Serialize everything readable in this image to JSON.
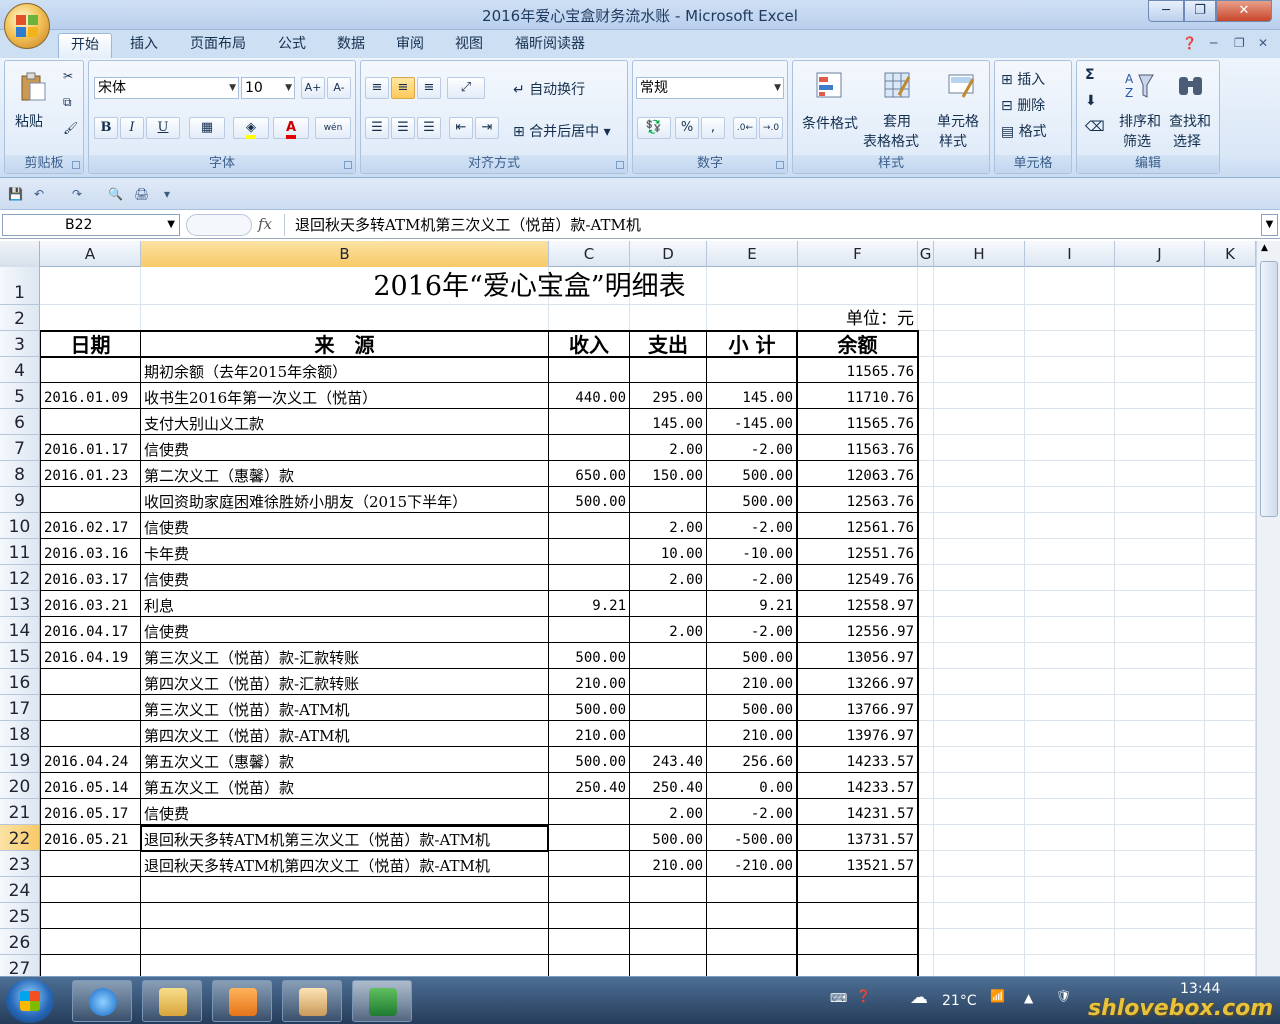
{
  "window": {
    "title": "2016年爱心宝盒财务流水账 - Microsoft Excel",
    "min": "─",
    "max": "❐",
    "close": "✕"
  },
  "tabs": [
    "开始",
    "插入",
    "页面布局",
    "公式",
    "数据",
    "审阅",
    "视图",
    "福昕阅读器"
  ],
  "ribbon": {
    "clipboard": {
      "paste": "粘贴",
      "label": "剪贴板"
    },
    "font": {
      "name": "宋体",
      "size": "10",
      "bold": "B",
      "italic": "I",
      "underline": "U",
      "label": "字体",
      "grow": "A+",
      "shrink": "A-",
      "phonetic": "wén"
    },
    "alignment": {
      "wrap": "自动换行",
      "merge": "合并后居中",
      "label": "对齐方式"
    },
    "number": {
      "format": "常规",
      "percent": "%",
      "comma": ",",
      "label": "数字"
    },
    "styles": {
      "conditional": "条件格式",
      "table_l1": "套用",
      "table_l2": "表格格式",
      "cell_l1": "单元格",
      "cell_l2": "样式",
      "label": "样式"
    },
    "cells": {
      "insert": "插入",
      "delete": "删除",
      "format": "格式",
      "label": "单元格"
    },
    "editing": {
      "sort_l1": "排序和",
      "sort_l2": "筛选",
      "find_l1": "查找和",
      "find_l2": "选择",
      "sum": "Σ",
      "label": "编辑"
    }
  },
  "formula_bar": {
    "name_box": "B22",
    "fx": "fx",
    "content": "退回秋天多转ATM机第三次义工（悦苗）款-ATM机"
  },
  "columns": [
    "A",
    "B",
    "C",
    "D",
    "E",
    "F",
    "G",
    "H",
    "I",
    "J",
    "K"
  ],
  "selected_column": "B",
  "selected_row": "22",
  "sheet": {
    "title": "2016年“爱心宝盒”明细表",
    "unit": "单位：元",
    "headers": {
      "date": "日期",
      "source": "来　源",
      "income": "收入",
      "expense": "支出",
      "subtotal": "小 计",
      "balance": "余额"
    },
    "rows": [
      {
        "r": "4",
        "date": "",
        "source": "期初余额（去年2015年余额）",
        "income": "",
        "expense": "",
        "subtotal": "",
        "balance": "11565.76"
      },
      {
        "r": "5",
        "date": "2016.01.09",
        "source": "收书生2016年第一次义工（悦苗）",
        "income": "440.00",
        "expense": "295.00",
        "subtotal": "145.00",
        "balance": "11710.76"
      },
      {
        "r": "6",
        "date": "",
        "source": "支付大别山义工款",
        "income": "",
        "expense": "145.00",
        "subtotal": "-145.00",
        "balance": "11565.76"
      },
      {
        "r": "7",
        "date": "2016.01.17",
        "source": "信使费",
        "income": "",
        "expense": "2.00",
        "subtotal": "-2.00",
        "balance": "11563.76"
      },
      {
        "r": "8",
        "date": "2016.01.23",
        "source": "第二次义工（惠馨）款",
        "income": "650.00",
        "expense": "150.00",
        "subtotal": "500.00",
        "balance": "12063.76"
      },
      {
        "r": "9",
        "date": "",
        "source": "收回资助家庭困难徐胜娇小朋友（2015下半年）",
        "income": "500.00",
        "expense": "",
        "subtotal": "500.00",
        "balance": "12563.76"
      },
      {
        "r": "10",
        "date": "2016.02.17",
        "source": "信使费",
        "income": "",
        "expense": "2.00",
        "subtotal": "-2.00",
        "balance": "12561.76"
      },
      {
        "r": "11",
        "date": "2016.03.16",
        "source": "卡年费",
        "income": "",
        "expense": "10.00",
        "subtotal": "-10.00",
        "balance": "12551.76"
      },
      {
        "r": "12",
        "date": "2016.03.17",
        "source": "信使费",
        "income": "",
        "expense": "2.00",
        "subtotal": "-2.00",
        "balance": "12549.76"
      },
      {
        "r": "13",
        "date": "2016.03.21",
        "source": "利息",
        "income": "9.21",
        "expense": "",
        "subtotal": "9.21",
        "balance": "12558.97"
      },
      {
        "r": "14",
        "date": "2016.04.17",
        "source": "信使费",
        "income": "",
        "expense": "2.00",
        "subtotal": "-2.00",
        "balance": "12556.97"
      },
      {
        "r": "15",
        "date": "2016.04.19",
        "source": "第三次义工（悦苗）款-汇款转账",
        "income": "500.00",
        "expense": "",
        "subtotal": "500.00",
        "balance": "13056.97"
      },
      {
        "r": "16",
        "date": "",
        "source": "第四次义工（悦苗）款-汇款转账",
        "income": "210.00",
        "expense": "",
        "subtotal": "210.00",
        "balance": "13266.97"
      },
      {
        "r": "17",
        "date": "",
        "source": "第三次义工（悦苗）款-ATM机",
        "income": "500.00",
        "expense": "",
        "subtotal": "500.00",
        "balance": "13766.97"
      },
      {
        "r": "18",
        "date": "",
        "source": "第四次义工（悦苗）款-ATM机",
        "income": "210.00",
        "expense": "",
        "subtotal": "210.00",
        "balance": "13976.97"
      },
      {
        "r": "19",
        "date": "2016.04.24",
        "source": "第五次义工（惠馨）款",
        "income": "500.00",
        "expense": "243.40",
        "subtotal": "256.60",
        "balance": "14233.57"
      },
      {
        "r": "20",
        "date": "2016.05.14",
        "source": "第五次义工（悦苗）款",
        "income": "250.40",
        "expense": "250.40",
        "subtotal": "0.00",
        "balance": "14233.57"
      },
      {
        "r": "21",
        "date": "2016.05.17",
        "source": "信使费",
        "income": "",
        "expense": "2.00",
        "subtotal": "-2.00",
        "balance": "14231.57"
      },
      {
        "r": "22",
        "date": "2016.05.21",
        "source": "退回秋天多转ATM机第三次义工（悦苗）款-ATM机",
        "income": "",
        "expense": "500.00",
        "subtotal": "-500.00",
        "balance": "13731.57"
      },
      {
        "r": "23",
        "date": "",
        "source": "退回秋天多转ATM机第四次义工（悦苗）款-ATM机",
        "income": "",
        "expense": "210.00",
        "subtotal": "-210.00",
        "balance": "13521.57"
      }
    ],
    "empty_rows": [
      "24",
      "25",
      "26",
      "27"
    ]
  },
  "taskbar": {
    "time": "13:44",
    "temperature": "21°C"
  },
  "watermark": "shlovebox.com",
  "colors": {
    "accent": "#f8c967",
    "ribbon": "#dae7f7",
    "taskbar": "#253c5a"
  }
}
